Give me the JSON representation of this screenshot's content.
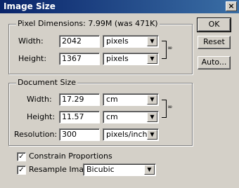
{
  "window": {
    "title": "Image Size",
    "close_glyph": "×"
  },
  "pixel_dimensions": {
    "label": "Pixel Dimensions: 7.99M (was 471K)",
    "width_label": "Width:",
    "width_value": "2042",
    "width_unit": "pixels",
    "height_label": "Height:",
    "height_value": "1367",
    "height_unit": "pixels"
  },
  "document_size": {
    "label": "Document Size",
    "width_label": "Width:",
    "width_value": "17.29",
    "width_unit": "cm",
    "height_label": "Height:",
    "height_value": "11.57",
    "height_unit": "cm",
    "resolution_label": "Resolution:",
    "resolution_value": "300",
    "resolution_unit": "pixels/inch"
  },
  "options": {
    "constrain_label": "Constrain Proportions",
    "constrain_checked": true,
    "resample_label": "Resample Image:",
    "resample_checked": true,
    "resample_method": "Bicubic",
    "check_glyph": "✓"
  },
  "buttons": {
    "ok": "OK",
    "reset": "Reset",
    "auto": "Auto..."
  },
  "icons": {
    "dropdown_arrow": "▼",
    "link": "chain-link-icon"
  }
}
